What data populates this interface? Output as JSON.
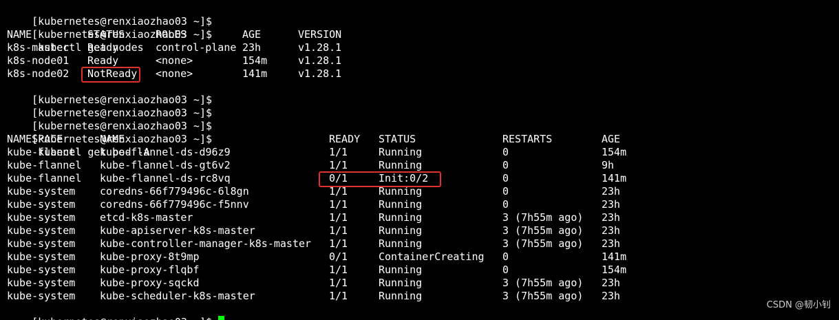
{
  "terminal": {
    "cut_text": "                                                                 ",
    "prompt": "[kubernetes@renxiaozhao03 ~]$",
    "commands": {
      "get_nodes": "kubectl get nodes",
      "get_pods": "kubectl get pod -A"
    },
    "nodes": {
      "headers": [
        "NAME",
        "STATUS",
        "ROLES",
        "AGE",
        "VERSION"
      ],
      "rows": [
        [
          "k8s-master",
          "Ready",
          "control-plane",
          "23h",
          "v1.28.1"
        ],
        [
          "k8s-node01",
          "Ready",
          "<none>",
          "154m",
          "v1.28.1"
        ],
        [
          "k8s-node02",
          "NotReady",
          "<none>",
          "141m",
          "v1.28.1"
        ]
      ]
    },
    "pods": {
      "headers": [
        "NAMESPACE",
        "NAME",
        "READY",
        "STATUS",
        "RESTARTS",
        "AGE"
      ],
      "rows": [
        [
          "kube-flannel",
          "kube-flannel-ds-d96z9",
          "1/1",
          "Running",
          "0",
          "154m"
        ],
        [
          "kube-flannel",
          "kube-flannel-ds-gt6v2",
          "1/1",
          "Running",
          "0",
          "9h"
        ],
        [
          "kube-flannel",
          "kube-flannel-ds-rc8vq",
          "0/1",
          "Init:0/2",
          "0",
          "141m"
        ],
        [
          "kube-system",
          "coredns-66f779496c-6l8gn",
          "1/1",
          "Running",
          "0",
          "23h"
        ],
        [
          "kube-system",
          "coredns-66f779496c-f5nnv",
          "1/1",
          "Running",
          "0",
          "23h"
        ],
        [
          "kube-system",
          "etcd-k8s-master",
          "1/1",
          "Running",
          "3 (7h55m ago)",
          "23h"
        ],
        [
          "kube-system",
          "kube-apiserver-k8s-master",
          "1/1",
          "Running",
          "3 (7h55m ago)",
          "23h"
        ],
        [
          "kube-system",
          "kube-controller-manager-k8s-master",
          "1/1",
          "Running",
          "3 (7h55m ago)",
          "23h"
        ],
        [
          "kube-system",
          "kube-proxy-8t9mp",
          "0/1",
          "ContainerCreating",
          "0",
          "141m"
        ],
        [
          "kube-system",
          "kube-proxy-flqbf",
          "1/1",
          "Running",
          "0",
          "154m"
        ],
        [
          "kube-system",
          "kube-proxy-sqckd",
          "1/1",
          "Running",
          "3 (7h55m ago)",
          "23h"
        ],
        [
          "kube-system",
          "kube-scheduler-k8s-master",
          "1/1",
          "Running",
          "3 (7h55m ago)",
          "23h"
        ]
      ]
    }
  },
  "watermark": "CSDN @韧小钊",
  "colors": {
    "background": "#000000",
    "text": "#ffffff",
    "cursor": "#00ff00",
    "highlight": "#e0322d"
  }
}
